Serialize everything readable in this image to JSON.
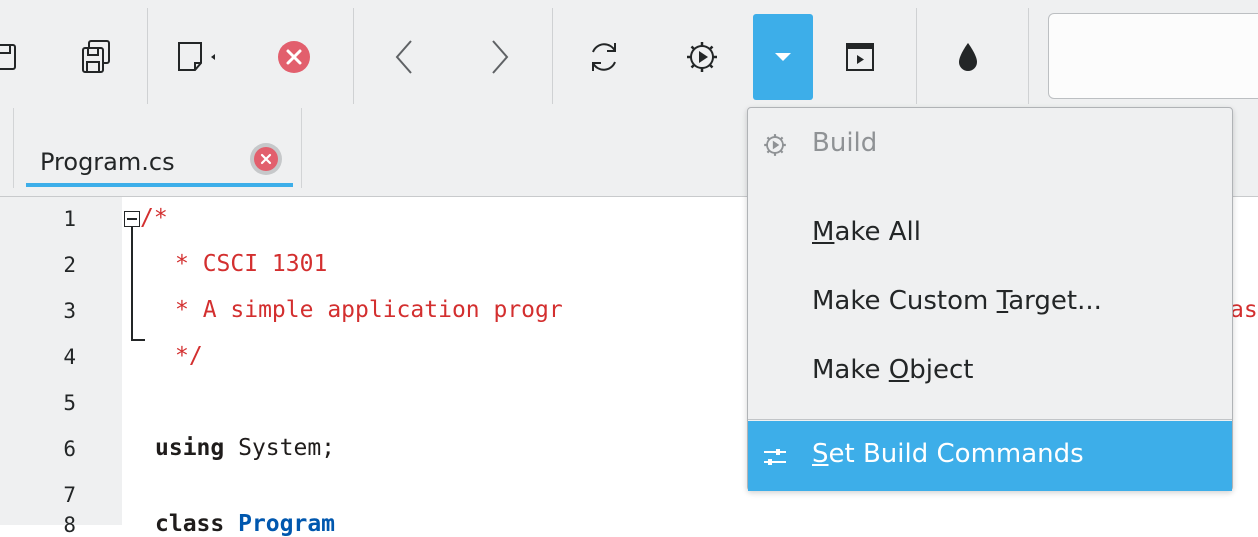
{
  "toolbar": {
    "buttons": [
      {
        "name": "open-icon"
      },
      {
        "name": "save-all-icon"
      },
      {
        "name": "new-file-menu-icon"
      },
      {
        "name": "close-icon"
      },
      {
        "name": "back-icon"
      },
      {
        "name": "forward-icon"
      },
      {
        "name": "reload-icon"
      },
      {
        "name": "build-icon"
      },
      {
        "name": "dropdown-icon"
      },
      {
        "name": "run-icon"
      },
      {
        "name": "color-icon"
      }
    ],
    "search_placeholder": "",
    "active_color": "#3daee9"
  },
  "tabs": [
    {
      "label": "Program.cs",
      "close_icon": "close-icon"
    }
  ],
  "editor": {
    "line_numbers": [
      "1",
      "2",
      "3",
      "4",
      "5",
      "6",
      "7",
      "8"
    ],
    "lines": [
      {
        "text": "/*"
      },
      {
        "text": "* CSCI 1301"
      },
      {
        "text": "* A simple application progr"
      },
      {
        "text": "*/"
      },
      {
        "text": ""
      },
      {
        "kw": "using",
        "rest": " System;"
      },
      {
        "text": ""
      },
      {
        "kw": "class",
        "type": " Program"
      }
    ],
    "overflow_text": "as",
    "comment_color": "#d32f2f",
    "type_color": "#0057ae"
  },
  "menu": {
    "items": [
      {
        "label": "Build",
        "icon": "build-icon",
        "disabled": true
      },
      {
        "label_before": "",
        "mnemonic": "M",
        "label_after": "ake All"
      },
      {
        "label_before": "Make Custom ",
        "mnemonic": "T",
        "label_after": "arget..."
      },
      {
        "label_before": "Make ",
        "mnemonic": "O",
        "label_after": "bject"
      },
      {
        "label_before": "",
        "mnemonic": "S",
        "label_after": "et Build Commands",
        "icon": "settings-sliders-icon",
        "highlighted": true
      }
    ],
    "highlight_color": "#3daee9"
  }
}
